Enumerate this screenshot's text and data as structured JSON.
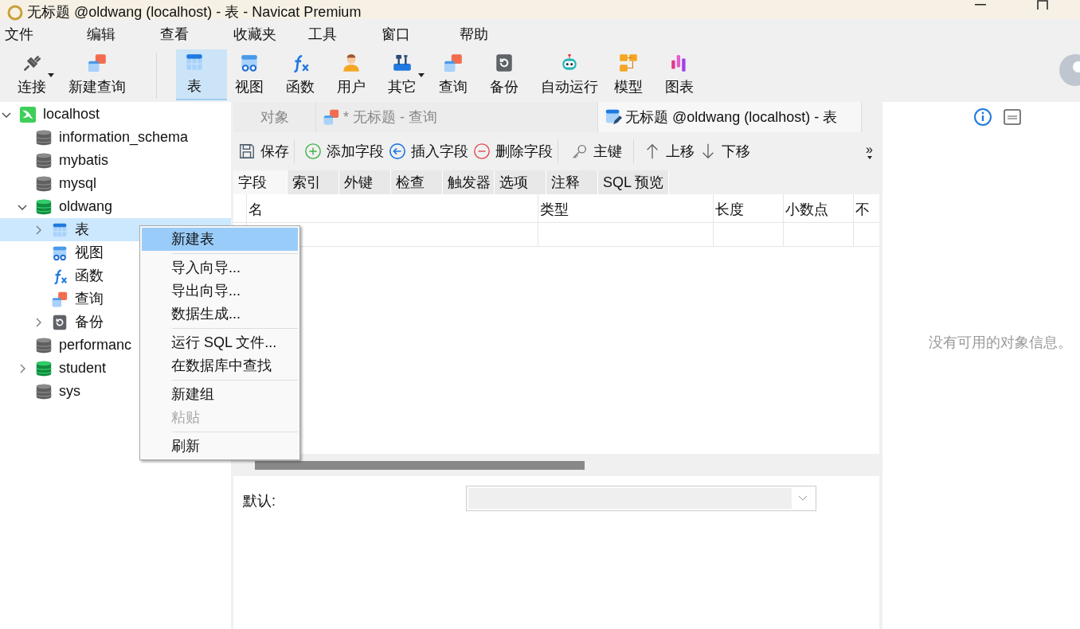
{
  "title_bar": {
    "title": "无标题 @oldwang (localhost) - 表 - Navicat Premium"
  },
  "menu_bar": [
    "文件",
    "编辑",
    "查看",
    "收藏夹",
    "工具",
    "窗口",
    "帮助"
  ],
  "toolbar": [
    {
      "label": "连接",
      "kind": "plug",
      "selected": false,
      "dropdown": true
    },
    {
      "label": "新建查询",
      "kind": "query",
      "selected": false,
      "dropdown": false
    },
    {
      "label": "表",
      "kind": "table",
      "selected": true,
      "dropdown": false
    },
    {
      "label": "视图",
      "kind": "view",
      "selected": false,
      "dropdown": false
    },
    {
      "label": "函数",
      "kind": "function",
      "selected": false,
      "dropdown": false
    },
    {
      "label": "用户",
      "kind": "user",
      "selected": false,
      "dropdown": false
    },
    {
      "label": "其它",
      "kind": "tools",
      "selected": false,
      "dropdown": true
    },
    {
      "label": "查询",
      "kind": "query",
      "selected": false,
      "dropdown": false
    },
    {
      "label": "备份",
      "kind": "backup",
      "selected": false,
      "dropdown": false
    },
    {
      "label": "自动运行",
      "kind": "robot",
      "selected": false,
      "dropdown": false
    },
    {
      "label": "模型",
      "kind": "model",
      "selected": false,
      "dropdown": false
    },
    {
      "label": "图表",
      "kind": "chart",
      "selected": false,
      "dropdown": false
    }
  ],
  "sidebar": {
    "tree": [
      {
        "label": "localhost",
        "kind": "server",
        "expanded": true,
        "selected": false,
        "children": [
          {
            "label": "information_schema",
            "kind": "db",
            "selected": false
          },
          {
            "label": "mybatis",
            "kind": "db",
            "selected": false
          },
          {
            "label": "mysql",
            "kind": "db",
            "selected": false
          },
          {
            "label": "oldwang",
            "kind": "db-open",
            "expanded": true,
            "selected": false,
            "children": [
              {
                "label": "表",
                "kind": "table",
                "expanded": false,
                "selected": true
              },
              {
                "label": "视图",
                "kind": "view",
                "selected": false
              },
              {
                "label": "函数",
                "kind": "function",
                "selected": false
              },
              {
                "label": "查询",
                "kind": "query",
                "selected": false
              },
              {
                "label": "备份",
                "kind": "backup",
                "expanded": false,
                "selected": false
              }
            ]
          },
          {
            "label": "performanc",
            "kind": "db",
            "selected": false
          },
          {
            "label": "student",
            "kind": "db-open",
            "expanded": false,
            "selected": false
          },
          {
            "label": "sys",
            "kind": "db",
            "selected": false
          }
        ]
      }
    ]
  },
  "context_menu": [
    [
      {
        "label": "新建表",
        "disabled": false,
        "selected": true
      }
    ],
    [
      {
        "label": "导入向导...",
        "disabled": false,
        "selected": false
      },
      {
        "label": "导出向导...",
        "disabled": false,
        "selected": false
      },
      {
        "label": "数据生成...",
        "disabled": false,
        "selected": false
      }
    ],
    [
      {
        "label": "运行 SQL 文件...",
        "disabled": false,
        "selected": false
      },
      {
        "label": "在数据库中查找",
        "disabled": false,
        "selected": false
      }
    ],
    [
      {
        "label": "新建组",
        "disabled": false,
        "selected": false
      },
      {
        "label": "粘贴",
        "disabled": true,
        "selected": false
      }
    ],
    [
      {
        "label": "刷新",
        "disabled": false,
        "selected": false
      }
    ]
  ],
  "tabs": [
    {
      "label": "对象",
      "kind": "plain",
      "selected": false
    },
    {
      "label": "* 无标题 - 查询",
      "kind": "query",
      "selected": false
    },
    {
      "label": "无标题 @oldwang (localhost) - 表",
      "kind": "table-edit",
      "selected": true
    }
  ],
  "editor_toolbar": [
    {
      "label": "保存",
      "kind": "save"
    },
    {
      "label": "添加字段",
      "kind": "add"
    },
    {
      "label": "插入字段",
      "kind": "insert"
    },
    {
      "label": "删除字段",
      "kind": "delete"
    },
    {
      "label": "主键",
      "kind": "key"
    },
    {
      "label": "上移",
      "kind": "up"
    },
    {
      "label": "下移",
      "kind": "down"
    }
  ],
  "overflow": "»",
  "sub_tabs": [
    {
      "label": "字段",
      "selected": true
    },
    {
      "label": "索引",
      "selected": false
    },
    {
      "label": "外键",
      "selected": false
    },
    {
      "label": "检查",
      "selected": false
    },
    {
      "label": "触发器",
      "selected": false
    },
    {
      "label": "选项",
      "selected": false
    },
    {
      "label": "注释",
      "selected": false
    },
    {
      "label": "SQL 预览",
      "selected": false
    }
  ],
  "grid": {
    "columns": [
      "名",
      "类型",
      "长度",
      "小数点",
      "不"
    ]
  },
  "default_field": {
    "label": "默认:",
    "disabled": true
  },
  "info_panel": {
    "message": "没有可用的对象信息。"
  }
}
